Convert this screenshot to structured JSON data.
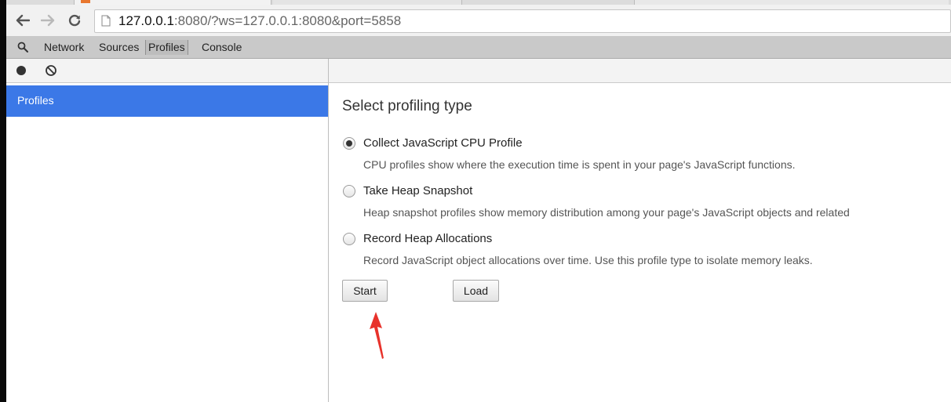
{
  "browser": {
    "url_host": "127.0.0.1",
    "url_rest": ":8080/?ws=127.0.0.1:8080&port=5858",
    "icons": {
      "back": "arrow-left-icon",
      "forward": "arrow-right-icon",
      "reload": "reload-icon",
      "page": "page-icon"
    }
  },
  "devtools": {
    "tabs": [
      {
        "label": "Network"
      },
      {
        "label": "Sources"
      },
      {
        "label": "Profiles",
        "selected": true
      },
      {
        "label": "Console"
      }
    ],
    "search_icon": "magnifier-icon"
  },
  "sidebar": {
    "item_label": "Profiles",
    "selected_color": "#3b78e7"
  },
  "main": {
    "heading": "Select profiling type",
    "options": [
      {
        "label": "Collect JavaScript CPU Profile",
        "description": "CPU profiles show where the execution time is spent in your page's JavaScript functions.",
        "checked": true
      },
      {
        "label": "Take Heap Snapshot",
        "description": "Heap snapshot profiles show memory distribution among your page's JavaScript objects and related",
        "checked": false
      },
      {
        "label": "Record Heap Allocations",
        "description": "Record JavaScript object allocations over time. Use this profile type to isolate memory leaks.",
        "checked": false
      }
    ],
    "start_label": "Start",
    "load_label": "Load"
  },
  "annotation": {
    "arrow_color": "#e8322b"
  }
}
